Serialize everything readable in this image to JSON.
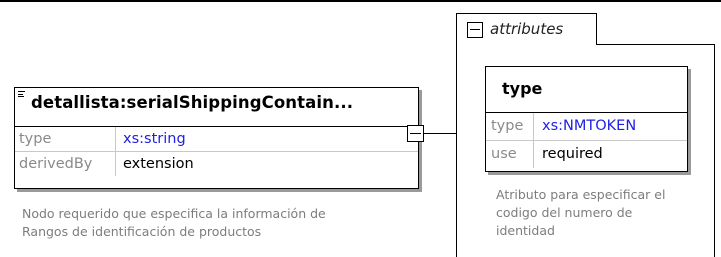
{
  "element": {
    "title": "detallista:serialShippingContain...",
    "properties": [
      {
        "key": "type",
        "value": "xs:string"
      },
      {
        "key": "derivedBy",
        "value": "extension"
      }
    ],
    "documentation_line1": "Nodo requerido que especifica la información de",
    "documentation_line2": "Rangos de identificación de productos"
  },
  "attributes_group": {
    "label": "attributes",
    "attribute": {
      "name": "type",
      "properties": [
        {
          "key": "type",
          "value": "xs:NMTOKEN"
        },
        {
          "key": "use",
          "value": "required"
        }
      ],
      "documentation_line1": "Atributo para especificar el",
      "documentation_line2": "codigo del numero de",
      "documentation_line3": "identidad"
    }
  },
  "colors": {
    "link": "#1e1ee6",
    "muted_text": "#7d7d7d",
    "shadow": "#9a9a9a"
  },
  "icons": [
    "element-icon",
    "collapse-icon",
    "attributes-collapse-icon"
  ]
}
